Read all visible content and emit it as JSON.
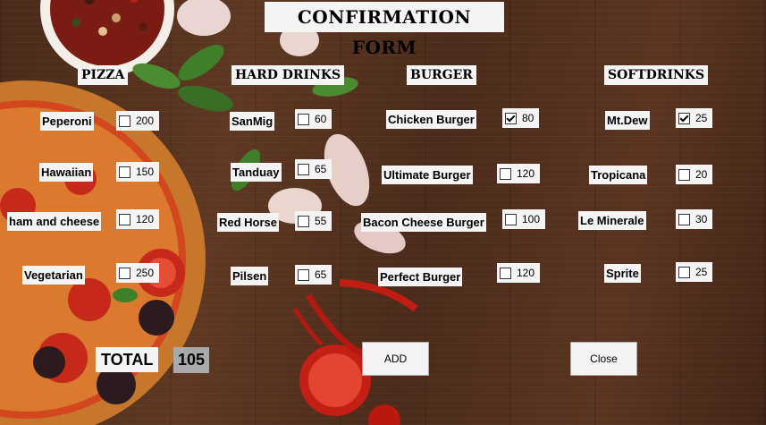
{
  "form": {
    "title": "CONFIRMATION FORM"
  },
  "categories": {
    "pizza": "PIZZA",
    "hard_drinks": "HARD DRINKS",
    "burger": "BURGER",
    "softdrinks": "SOFTDRINKS"
  },
  "pizza": [
    {
      "name": "Peperoni",
      "price": "200",
      "checked": false
    },
    {
      "name": "Hawaiian",
      "price": "150",
      "checked": false
    },
    {
      "name": "ham and cheese",
      "price": "120",
      "checked": false
    },
    {
      "name": "Vegetarian",
      "price": "250",
      "checked": false
    }
  ],
  "hard_drinks": [
    {
      "name": "SanMig",
      "price": "60",
      "checked": false
    },
    {
      "name": "Tanduay",
      "price": "65",
      "checked": false
    },
    {
      "name": "Red Horse",
      "price": "55",
      "checked": false
    },
    {
      "name": "Pilsen",
      "price": "65",
      "checked": false
    }
  ],
  "burger": [
    {
      "name": "Chicken Burger",
      "price": "80",
      "checked": true
    },
    {
      "name": "Ultimate Burger",
      "price": "120",
      "checked": false
    },
    {
      "name": "Bacon Cheese Burger",
      "price": "100",
      "checked": false
    },
    {
      "name": "Perfect Burger",
      "price": "120",
      "checked": false
    }
  ],
  "softdrinks": [
    {
      "name": "Mt.Dew",
      "price": "25",
      "checked": true
    },
    {
      "name": "Tropicana",
      "price": "20",
      "checked": false
    },
    {
      "name": "Le Minerale",
      "price": "30",
      "checked": false
    },
    {
      "name": "Sprite",
      "price": "25",
      "checked": false
    }
  ],
  "total": {
    "label": "TOTAL",
    "value": "105"
  },
  "buttons": {
    "add": "ADD",
    "close": "Close"
  },
  "colors": {
    "wood": "#5e3822",
    "panel": "#f4f4f4",
    "total_box": "#a9a9a9"
  }
}
